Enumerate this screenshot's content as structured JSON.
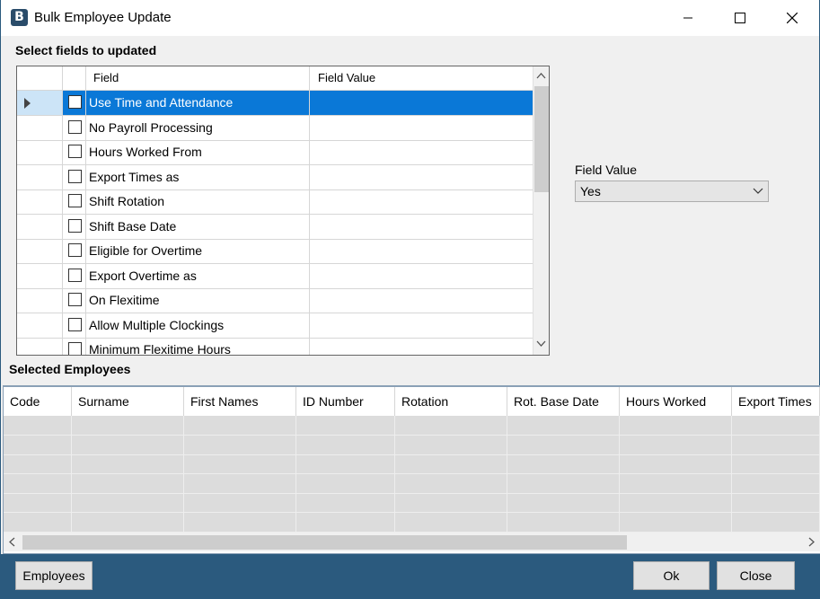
{
  "window": {
    "title": "Bulk Employee Update",
    "icon": "app-logo-icon",
    "controls": [
      "minimize-icon",
      "maximize-icon",
      "close-icon"
    ]
  },
  "fields_section": {
    "label": "Select fields to updated",
    "columns": {
      "field": "Field",
      "value": "Field Value"
    },
    "rows": [
      {
        "field": "Use Time and Attendance",
        "value": "",
        "checked": false,
        "selected": true
      },
      {
        "field": "No Payroll Processing",
        "value": "",
        "checked": false,
        "selected": false
      },
      {
        "field": "Hours Worked From",
        "value": "",
        "checked": false,
        "selected": false
      },
      {
        "field": "Export Times as",
        "value": "",
        "checked": false,
        "selected": false
      },
      {
        "field": "Shift Rotation",
        "value": "",
        "checked": false,
        "selected": false
      },
      {
        "field": "Shift Base Date",
        "value": "",
        "checked": false,
        "selected": false
      },
      {
        "field": "Eligible for Overtime",
        "value": "",
        "checked": false,
        "selected": false
      },
      {
        "field": "Export Overtime as",
        "value": "",
        "checked": false,
        "selected": false
      },
      {
        "field": "On Flexitime",
        "value": "",
        "checked": false,
        "selected": false
      },
      {
        "field": "Allow Multiple Clockings",
        "value": "",
        "checked": false,
        "selected": false
      },
      {
        "field": "Minimum Flexitime Hours",
        "value": "",
        "checked": false,
        "selected": false
      }
    ]
  },
  "field_value_panel": {
    "label": "Field Value",
    "selected": "Yes"
  },
  "employees_section": {
    "label": "Selected Employees",
    "columns": [
      "Code",
      "Surname",
      "First Names",
      "ID Number",
      "Rotation",
      "Rot. Base Date",
      "Hours Worked",
      "Export Times"
    ],
    "row_count": 6
  },
  "footer": {
    "employees_button": "Employees",
    "ok_button": "Ok",
    "close_button": "Close"
  },
  "colors": {
    "selection": "#0a78d7",
    "footer": "#2b5a7e",
    "window_bg": "#f0f0f0"
  }
}
